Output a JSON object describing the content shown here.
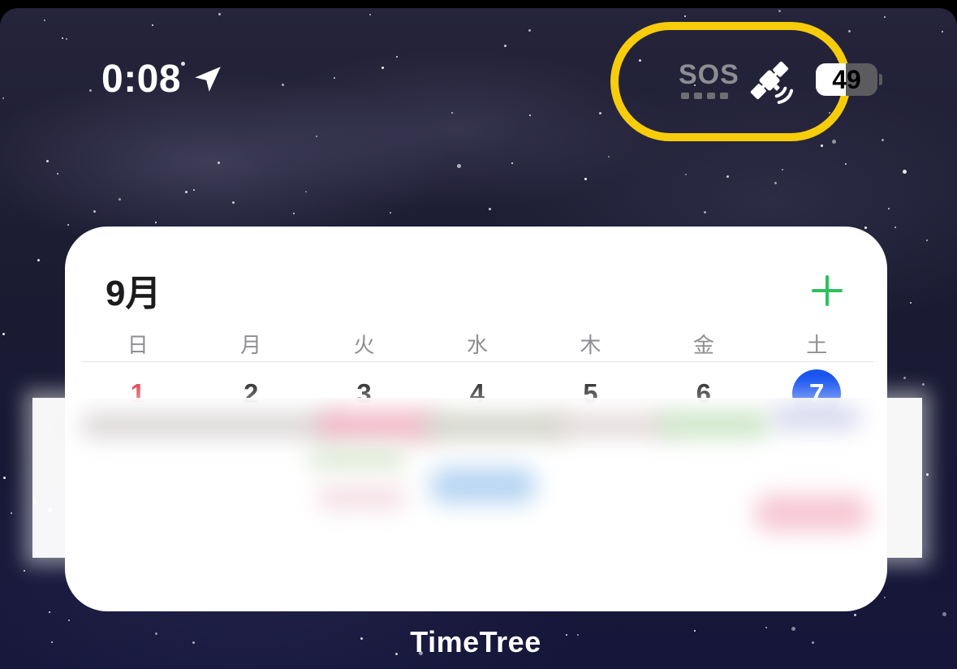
{
  "status_bar": {
    "time": "0:08",
    "location_icon": "location-arrow-icon",
    "sos_label": "SOS",
    "satellite_icon": "satellite-icon",
    "battery_level": "49",
    "battery_fraction": 0.49
  },
  "widget": {
    "month": "9月",
    "add_icon": "plus-icon",
    "weekdays": [
      "日",
      "月",
      "火",
      "水",
      "木",
      "金",
      "土"
    ],
    "dates": [
      "1",
      "2",
      "3",
      "4",
      "5",
      "6",
      "7"
    ],
    "today": "7",
    "colors": {
      "sunday": "#e0343f",
      "today_circle": "#1652f0",
      "add": "#2fc05c"
    }
  },
  "annotation": {
    "highlight_color": "#f7cc0a"
  },
  "app_label": "TimeTree"
}
